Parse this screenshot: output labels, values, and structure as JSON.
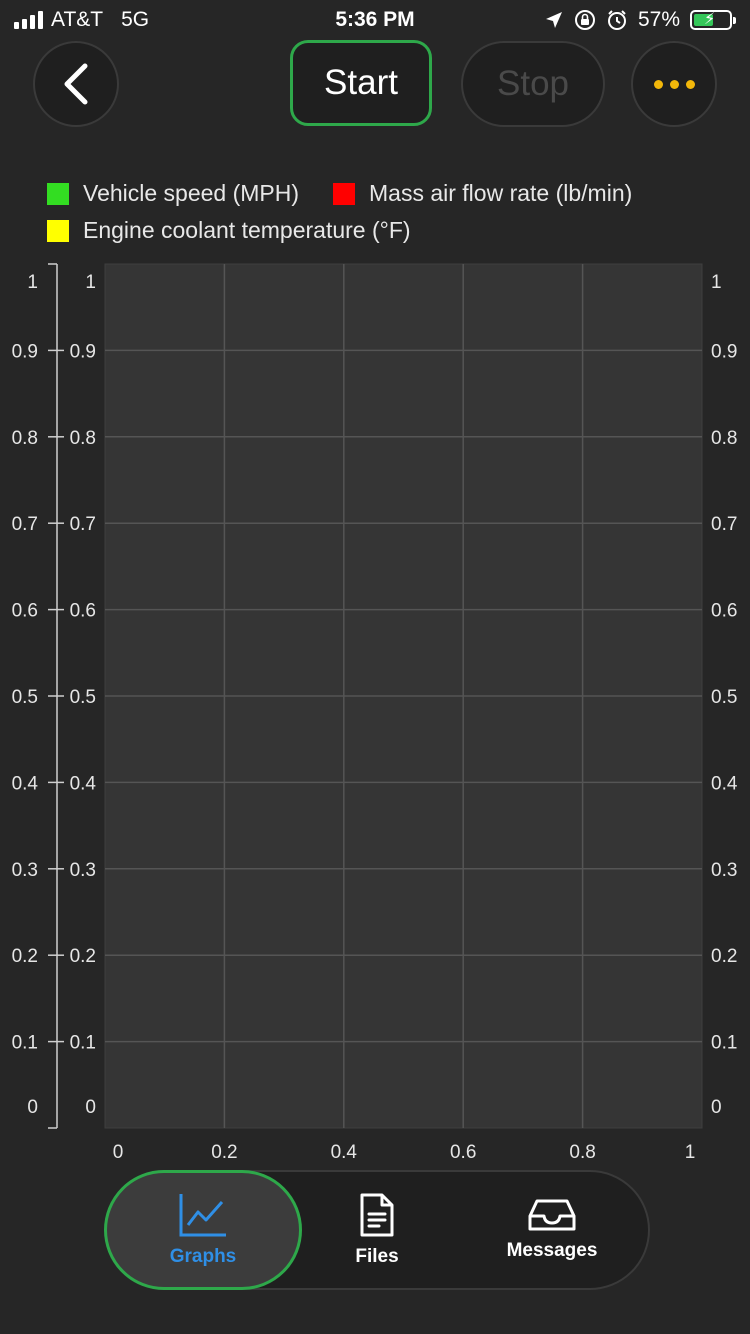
{
  "status_bar": {
    "carrier": "AT&T",
    "network": "5G",
    "time": "5:36 PM",
    "battery_percent": "57%",
    "battery_level": 0.57
  },
  "toolbar": {
    "start_label": "Start",
    "stop_label": "Stop"
  },
  "legend": [
    {
      "label": "Vehicle speed (MPH)",
      "color": "#33dd22"
    },
    {
      "label": "Mass air flow rate (lb/min)",
      "color": "#ff0000"
    },
    {
      "label": "Engine coolant temperature (°F)",
      "color": "#ffff00"
    }
  ],
  "chart_data": {
    "type": "line",
    "series": [
      {
        "name": "Vehicle speed (MPH)",
        "values": []
      },
      {
        "name": "Mass air flow rate (lb/min)",
        "values": []
      },
      {
        "name": "Engine coolant temperature (°F)",
        "values": []
      }
    ],
    "xlim": [
      0,
      1
    ],
    "ylim": [
      0,
      1
    ],
    "x_ticks": [
      "0",
      "0.2",
      "0.4",
      "0.6",
      "0.8",
      "1"
    ],
    "y_ticks": [
      "0",
      "0.1",
      "0.2",
      "0.3",
      "0.4",
      "0.5",
      "0.6",
      "0.7",
      "0.8",
      "0.9",
      "1"
    ],
    "grid": true,
    "legend_position": "top-left"
  },
  "tabs": [
    {
      "label": "Graphs",
      "icon": "line-chart-icon",
      "active": true
    },
    {
      "label": "Files",
      "icon": "document-icon",
      "active": false
    },
    {
      "label": "Messages",
      "icon": "inbox-icon",
      "active": false
    }
  ]
}
